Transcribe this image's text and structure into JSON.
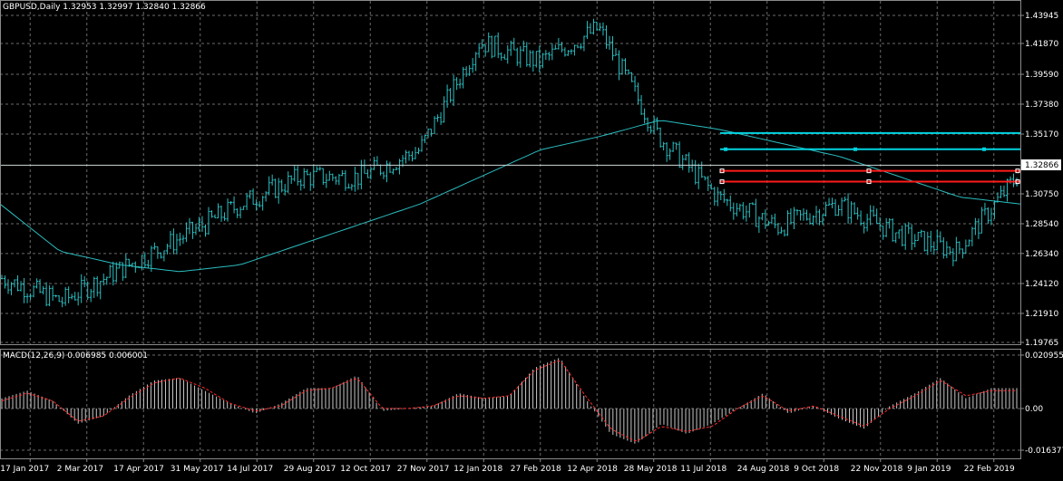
{
  "window": {
    "symbol_info": "GBPUSD,Daily  1.32953 1.32997 1.32840 1.32866",
    "current_price": "1.32866"
  },
  "colors": {
    "background": "#000000",
    "grid": "#6b6b6b",
    "candle": "#2bbdc0",
    "ma_line": "#2bbdc0",
    "hline_cyan": "#00d4e0",
    "hline_red": "#ff1a1a",
    "macd_hist": "#c8c8c8",
    "macd_signal": "#ff2a2a",
    "text": "#ffffff"
  },
  "price_axis": {
    "labels": [
      "1.43945",
      "1.41870",
      "1.39590",
      "1.37380",
      "1.35170",
      "1.30750",
      "1.28540",
      "1.26340",
      "1.24120",
      "1.21910",
      "1.19765"
    ]
  },
  "macd_panel": {
    "label": "MACD(12,26,9) 0.006985 0.006001",
    "axis_labels": [
      "0.020955",
      "0.00",
      "-0.016377"
    ]
  },
  "time_axis": {
    "labels": [
      "17 Jan 2017",
      "2 Mar 2017",
      "17 Apr 2017",
      "31 May 2017",
      "14 Jul 2017",
      "29 Aug 2017",
      "12 Oct 2017",
      "27 Nov 2017",
      "12 Jan 2018",
      "27 Feb 2018",
      "12 Apr 2018",
      "28 May 2018",
      "11 Jul 2018",
      "24 Aug 2018",
      "9 Oct 2018",
      "22 Nov 2018",
      "9 Jan 2019",
      "22 Feb 2019"
    ]
  },
  "chart_data": {
    "type": "line",
    "title": "GBPUSD,Daily  1.32953 1.32997 1.32840 1.32866",
    "xlabel": "",
    "ylabel": "",
    "ylim": [
      1.19765,
      1.43945
    ],
    "grid": true,
    "x": [
      "17 Jan 2017",
      "2 Mar 2017",
      "17 Apr 2017",
      "31 May 2017",
      "14 Jul 2017",
      "29 Aug 2017",
      "12 Oct 2017",
      "27 Nov 2017",
      "12 Jan 2018",
      "27 Feb 2018",
      "12 Apr 2018",
      "28 May 2018",
      "11 Jul 2018",
      "24 Aug 2018",
      "9 Oct 2018",
      "22 Nov 2018",
      "9 Jan 2019",
      "22 Feb 2019"
    ],
    "series": [
      {
        "values": [
          1.245,
          1.228,
          1.252,
          1.275,
          1.3,
          1.32,
          1.32,
          1.34,
          1.42,
          1.405,
          1.43,
          1.35,
          1.305,
          1.283,
          1.3,
          1.278,
          1.265,
          1.32
        ]
      },
      {
        "values": [
          1.3,
          1.265,
          1.255,
          1.25,
          1.255,
          1.27,
          1.285,
          1.3,
          1.32,
          1.34,
          1.35,
          1.362,
          1.355,
          1.345,
          1.335,
          1.32,
          1.305,
          1.3
        ]
      }
    ],
    "horizontal_levels": {
      "cyan": [
        1.3525,
        1.3405,
        1.32866
      ],
      "red": [
        1.3245,
        1.3165
      ]
    },
    "macd": {
      "ylim": [
        -0.016377,
        0.020955
      ],
      "histogram": [
        0.004,
        0.007,
        0.003,
        -0.006,
        -0.003,
        0.005,
        0.011,
        0.012,
        0.007,
        0.002,
        -0.002,
        0.002,
        0.008,
        0.008,
        0.013,
        -0.001,
        0.0,
        0.001,
        0.006,
        0.004,
        0.005,
        0.016,
        0.02,
        0.004,
        -0.01,
        -0.014,
        -0.006,
        -0.01,
        -0.006,
        0.0,
        0.006,
        -0.002,
        0.001,
        -0.004,
        -0.008,
        0.001,
        0.006,
        0.012,
        0.004,
        0.008,
        0.008
      ],
      "signal": [
        0.003,
        0.006,
        0.003,
        -0.005,
        -0.003,
        0.004,
        0.01,
        0.012,
        0.008,
        0.002,
        -0.001,
        0.001,
        0.007,
        0.008,
        0.012,
        0.0,
        0.0,
        0.001,
        0.005,
        0.004,
        0.005,
        0.015,
        0.019,
        0.005,
        -0.008,
        -0.013,
        -0.007,
        -0.009,
        -0.007,
        0.0,
        0.005,
        -0.001,
        0.001,
        -0.003,
        -0.007,
        0.0,
        0.005,
        0.011,
        0.005,
        0.007,
        0.007
      ]
    }
  }
}
